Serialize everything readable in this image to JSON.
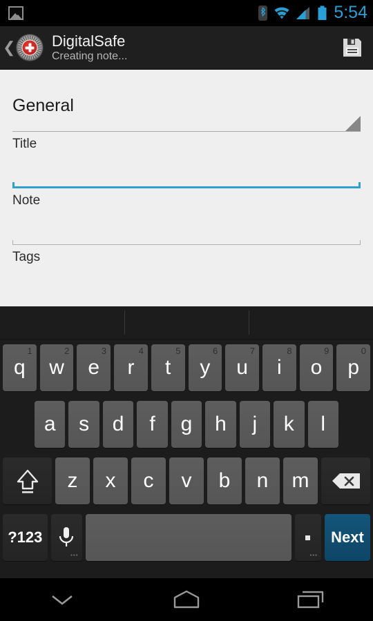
{
  "status_bar": {
    "notification_icon": "image-icon",
    "icons": [
      "bluetooth-icon",
      "wifi-icon",
      "cellular-signal-icon",
      "battery-icon"
    ],
    "time": "5:54",
    "time_color": "#2a9fd6"
  },
  "action_bar": {
    "back_label": "❮",
    "app_icon": "digitalsafe-dial-icon",
    "title": "DigitalSafe",
    "subtitle": "Creating note...",
    "save_icon": "save-floppy-icon"
  },
  "form": {
    "category": {
      "value": "General",
      "indicator": "spinner-triangle-icon"
    },
    "fields": [
      {
        "hint": "Title",
        "value": "",
        "focused": true
      },
      {
        "hint": "Note",
        "value": "",
        "focused": false
      },
      {
        "hint": "Tags",
        "value": "",
        "focused": false
      }
    ],
    "focus_color": "#2f9fd0",
    "background": "#efefef"
  },
  "keyboard": {
    "suggestions": [
      "",
      "",
      ""
    ],
    "row1": [
      {
        "label": "q",
        "num": "1"
      },
      {
        "label": "w",
        "num": "2"
      },
      {
        "label": "e",
        "num": "3"
      },
      {
        "label": "r",
        "num": "4"
      },
      {
        "label": "t",
        "num": "5"
      },
      {
        "label": "y",
        "num": "6"
      },
      {
        "label": "u",
        "num": "7"
      },
      {
        "label": "i",
        "num": "8"
      },
      {
        "label": "o",
        "num": "9"
      },
      {
        "label": "p",
        "num": "0"
      }
    ],
    "row2": [
      {
        "label": "a"
      },
      {
        "label": "s"
      },
      {
        "label": "d"
      },
      {
        "label": "f"
      },
      {
        "label": "g"
      },
      {
        "label": "h"
      },
      {
        "label": "j"
      },
      {
        "label": "k"
      },
      {
        "label": "l"
      }
    ],
    "row3": {
      "shift_icon": "shift-arrow-icon",
      "keys": [
        {
          "label": "z"
        },
        {
          "label": "x"
        },
        {
          "label": "c"
        },
        {
          "label": "v"
        },
        {
          "label": "b"
        },
        {
          "label": "n"
        },
        {
          "label": "m"
        }
      ],
      "delete_icon": "backspace-icon"
    },
    "row4": {
      "symbols_label": "?123",
      "mic_icon": "microphone-icon",
      "space_label": "",
      "period_label": ".",
      "action_label": "Next",
      "action_color": "#0e4566"
    }
  },
  "nav_bar": {
    "back_icon": "hide-keyboard-chevron-icon",
    "home_icon": "home-icon",
    "recents_icon": "recents-icon"
  }
}
